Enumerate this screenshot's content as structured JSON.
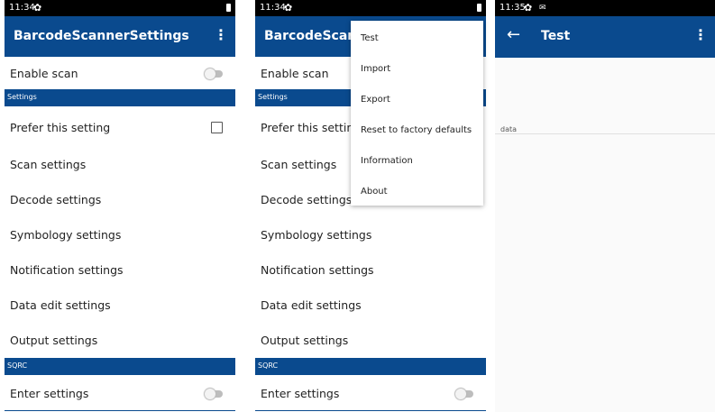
{
  "screens": [
    {
      "status": {
        "time": "11:34"
      },
      "appbar": {
        "title": "BarcodeScannerSettings"
      },
      "rows": {
        "enable_scan": "Enable scan",
        "settings_header": "Settings",
        "prefer": "Prefer this setting",
        "scan": "Scan settings",
        "decode": "Decode settings",
        "symbology": "Symbology settings",
        "notification": "Notification settings",
        "data_edit": "Data edit settings",
        "output": "Output settings",
        "sqrc_header": "SQRC",
        "enter": "Enter settings"
      }
    },
    {
      "status": {
        "time": "11:34"
      },
      "appbar": {
        "title": "BarcodeScannerSettings"
      },
      "rows": {
        "enable_scan": "Enable scan",
        "settings_header": "Settings",
        "prefer": "Prefer this setting",
        "scan": "Scan settings",
        "decode": "Decode settings",
        "symbology": "Symbology settings",
        "notification": "Notification settings",
        "data_edit": "Data edit settings",
        "output": "Output settings",
        "sqrc_header": "SQRC",
        "enter": "Enter settings"
      },
      "menu": [
        "Test",
        "Import",
        "Export",
        "Reset to factory defaults",
        "Information",
        "About"
      ]
    },
    {
      "status": {
        "time": "11:35"
      },
      "appbar": {
        "title": "Test"
      },
      "data_label": "data"
    }
  ],
  "colors": {
    "primary": "#0a4a8e",
    "statusbar": "#000000"
  },
  "icons": [
    "gear-icon",
    "mail-icon",
    "battery-icon",
    "more-vert-icon",
    "back-arrow-icon"
  ]
}
